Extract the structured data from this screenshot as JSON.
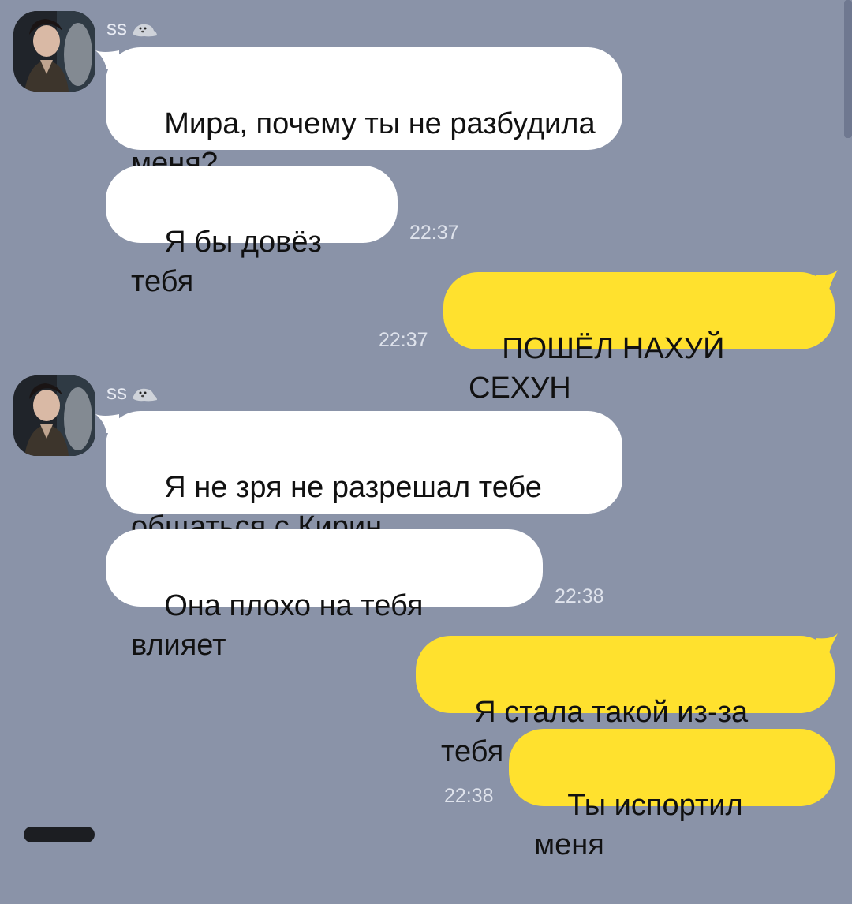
{
  "colors": {
    "background": "#8a93a8",
    "incoming_bubble": "#ffffff",
    "outgoing_bubble": "#ffe12e",
    "timestamp": "#dfe3ec",
    "sender_name": "#e8ebf3"
  },
  "groups": [
    {
      "sender": "ss",
      "sender_icon": "seal-icon",
      "messages": [
        "Мира, почему ты не разбудила\nменя?",
        "Я бы довёз тебя"
      ],
      "time": "22:37"
    },
    {
      "outgoing": true,
      "messages": [
        "ПОШЁЛ НАХУЙ СЕХУН"
      ],
      "time": "22:37"
    },
    {
      "sender": "ss",
      "sender_icon": "seal-icon",
      "messages": [
        "Я не зря не разрешал тебе\nобщаться с Кирин",
        "Она плохо на тебя влияет"
      ],
      "time": "22:38"
    },
    {
      "outgoing": true,
      "messages": [
        "Я стала такой из-за тебя",
        "Ты испортил меня"
      ],
      "time": "22:38"
    }
  ]
}
